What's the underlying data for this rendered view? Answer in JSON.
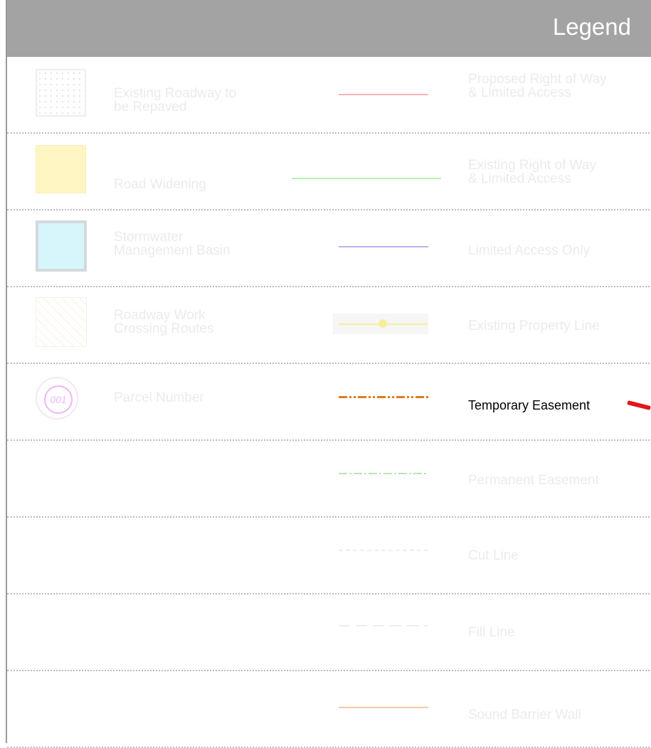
{
  "legend": {
    "title": "Legend",
    "rows": [
      {
        "left_label": "Existing Roadway to\nbe Repaved",
        "right_label": "Proposed Right of Way\n& Limited Access"
      },
      {
        "left_label": "Road Widening",
        "right_label": "Existing Right of Way\n& Limited Access"
      },
      {
        "left_label": "Stormwater\nManagement Basin",
        "right_label": "Limited Access Only"
      },
      {
        "left_label": "Roadway Work\nCrossing Routes",
        "right_label": "Existing Property Line"
      },
      {
        "left_label": "Parcel Number",
        "parcel_symbol_text": "001",
        "right_label": "Temporary Easement"
      },
      {
        "left_label": "",
        "right_label": "Permanent Easement"
      },
      {
        "left_label": "",
        "right_label": "Cut Line"
      },
      {
        "left_label": "",
        "right_label": "Fill Line"
      },
      {
        "left_label": "",
        "right_label": "Sound Barrier Wall"
      }
    ],
    "highlighted_item": "Temporary Easement"
  },
  "colors": {
    "header": "#a3a3a3",
    "proposed_row": "#f6b3b8",
    "existing_row": "#b9f2b4",
    "limited_access": "#b8b8f0",
    "property_line": "#f5f0a0",
    "temporary_easement": "#e07b1e",
    "permanent_easement": "#b5e8b0",
    "sound_barrier": "#f7c9a0",
    "road_widening": "#fff6c4",
    "stormwater": "#d6f6fb",
    "parcel_circle": "#f0b6f4",
    "pointer_arrow": "#e3161b"
  }
}
